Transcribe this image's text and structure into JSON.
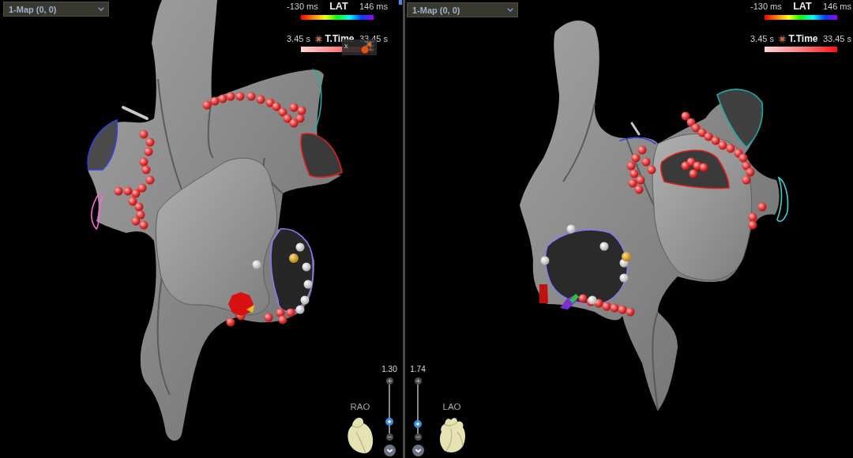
{
  "views": [
    {
      "map_selector": "1-Map (0, 0)",
      "lat_legend": {
        "min": "-130 ms",
        "title": "LAT",
        "max": "146 ms"
      },
      "time_legend": {
        "min": "3.45 s",
        "title": "T.Time",
        "max": "33.45 s"
      },
      "tag_preview": {
        "mark": "x"
      },
      "zoom": {
        "value": "1.30",
        "level": 0.19
      },
      "orientation": "RAO"
    },
    {
      "map_selector": "1-Map (0, 0)",
      "lat_legend": {
        "min": "-130 ms",
        "title": "LAT",
        "max": "146 ms"
      },
      "time_legend": {
        "min": "3.45 s",
        "title": "T.Time",
        "max": "33.45 s"
      },
      "zoom": {
        "value": "1.74",
        "level": 0.13
      },
      "orientation": "LAO"
    }
  ]
}
